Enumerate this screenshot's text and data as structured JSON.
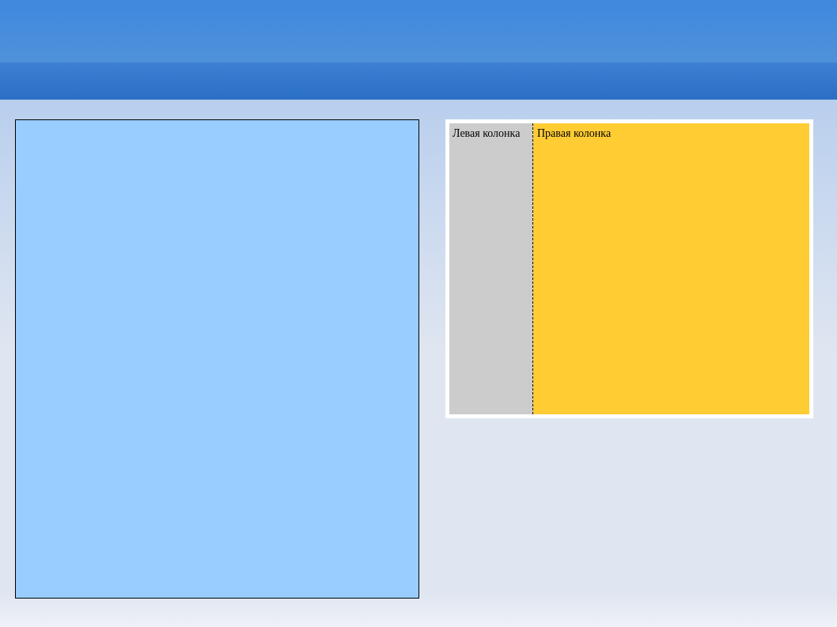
{
  "layout_demo": {
    "left_column": {
      "label": "Левая колонка"
    },
    "right_column": {
      "label": "Правая колонка"
    }
  }
}
